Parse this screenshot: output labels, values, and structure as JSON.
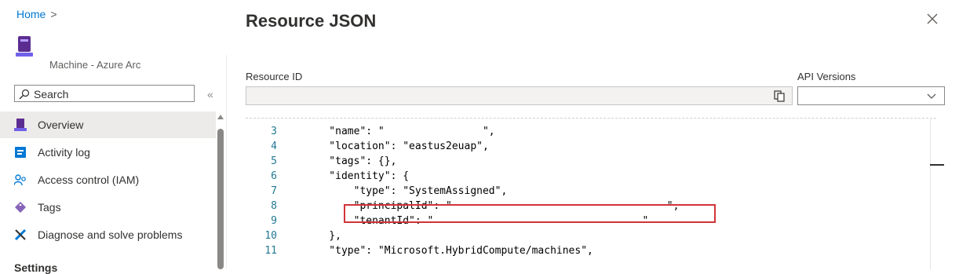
{
  "breadcrumb": {
    "home": "Home",
    "separator": ">"
  },
  "resource": {
    "type_label": "Machine - Azure Arc",
    "icon": "azure-arc-machine-icon"
  },
  "search": {
    "placeholder": "Search",
    "collapse": "«"
  },
  "nav": {
    "items": [
      {
        "label": "Overview",
        "icon": "overview-icon",
        "active": true
      },
      {
        "label": "Activity log",
        "icon": "activity-log-icon",
        "active": false
      },
      {
        "label": "Access control (IAM)",
        "icon": "access-control-icon",
        "active": false
      },
      {
        "label": "Tags",
        "icon": "tag-icon",
        "active": false
      },
      {
        "label": "Diagnose and solve problems",
        "icon": "wrench-icon",
        "active": false
      }
    ],
    "section_settings": "Settings"
  },
  "panel": {
    "title": "Resource JSON",
    "resource_id_label": "Resource ID",
    "resource_id_value": "",
    "api_versions_label": "API Versions",
    "api_versions_value": ""
  },
  "editor": {
    "lines": [
      {
        "n": "3",
        "code": "    \"name\": \"                \","
      },
      {
        "n": "4",
        "code": "    \"location\": \"eastus2euap\","
      },
      {
        "n": "5",
        "code": "    \"tags\": {},"
      },
      {
        "n": "6",
        "code": "    \"identity\": {"
      },
      {
        "n": "7",
        "code": "        \"type\": \"SystemAssigned\","
      },
      {
        "n": "8",
        "code": "        \"principalId\": \"                                   \","
      },
      {
        "n": "9",
        "code": "        \"tenantId\": \"                                  \""
      },
      {
        "n": "10",
        "code": "    },"
      },
      {
        "n": "11",
        "code": "    \"type\": \"Microsoft.HybridCompute/machines\","
      }
    ]
  },
  "colors": {
    "accent": "#0078d4",
    "highlight": "#d13438",
    "line_number": "#237893"
  }
}
